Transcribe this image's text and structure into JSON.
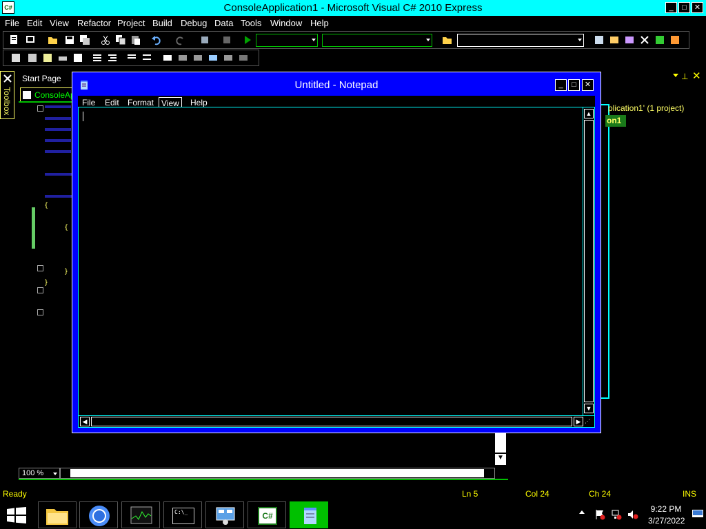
{
  "vs": {
    "title": "ConsoleApplication1 - Microsoft Visual C# 2010 Express",
    "app_icon": "C#",
    "menu": [
      "File",
      "Edit",
      "View",
      "Refactor",
      "Project",
      "Build",
      "Debug",
      "Data",
      "Tools",
      "Window",
      "Help"
    ],
    "window_buttons": [
      "_",
      "□",
      "✕"
    ]
  },
  "doc_tabs": {
    "start_page": "Start Page",
    "tab_active": "ConsoleAp"
  },
  "toolbox_label": "Toolbox",
  "solution_explorer": {
    "solution_text": "plication1' (1 project)",
    "project_text": "on1"
  },
  "editor": {
    "zoom": "100 %",
    "braces": [
      "{",
      "{",
      "}",
      "}"
    ]
  },
  "notepad": {
    "title": "Untitled - Notepad",
    "menu": [
      "File",
      "Edit",
      "Format",
      "View",
      "Help"
    ],
    "selected_menu": "View",
    "content": ""
  },
  "status": {
    "ready": "Ready",
    "ln": "Ln 5",
    "col": "Col 24",
    "ch": "Ch 24",
    "ins": "INS"
  },
  "taskbar": {
    "time": "9:22 PM",
    "date": "3/27/2022",
    "cmd_label": "C:\\_",
    "cs_label": "C#"
  },
  "colors": {
    "accent_cyan": "#00ffff",
    "notepad_blue": "#0000ff",
    "status_yellow": "#ffff00",
    "green": "#00c000"
  }
}
